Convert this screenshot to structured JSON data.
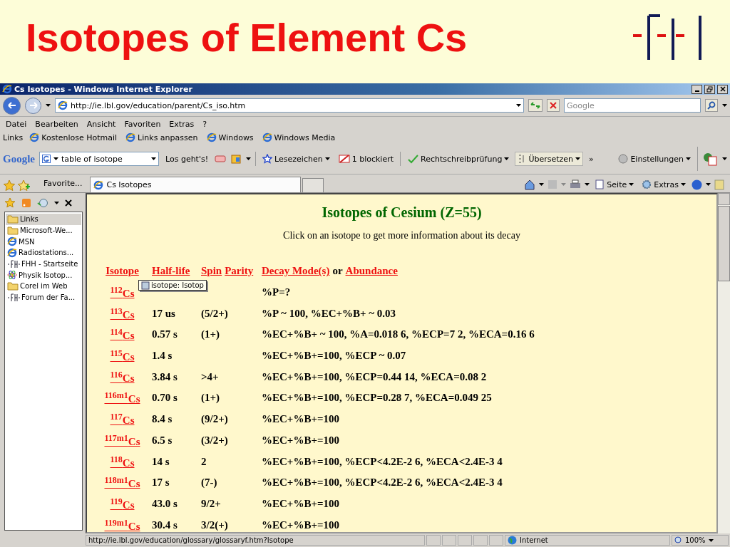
{
  "slide": {
    "title": "Isotopes of Element Cs"
  },
  "browser": {
    "title": "Cs Isotopes - Windows Internet Explorer",
    "address": "http://ie.lbl.gov/education/parent/Cs_iso.htm",
    "search_placeholder": "Google",
    "menu": [
      "Datei",
      "Bearbeiten",
      "Ansicht",
      "Favoriten",
      "Extras",
      "?"
    ],
    "links_bar": {
      "label": "Links",
      "items": [
        "Kostenlose Hotmail",
        "Links anpassen",
        "Windows",
        "Windows Media"
      ]
    },
    "google_toolbar": {
      "logo": "Google",
      "query": "table of isotope",
      "go": "Los geht's!",
      "bookmarks": "Lesezeichen",
      "blocked": "1 blockiert",
      "spellcheck": "Rechtschreibprüfung",
      "translate": "Übersetzen",
      "more": "»",
      "settings": "Einstellungen"
    },
    "favorites_button": "Favorite...",
    "tabs": [
      {
        "label": "Cs Isotopes",
        "selected": true
      }
    ],
    "commands": [
      "Seite",
      "Extras"
    ],
    "sidebar": {
      "items": [
        {
          "kind": "folder",
          "label": "Links",
          "selected": true
        },
        {
          "kind": "folder",
          "label": "Microsoft-We...",
          "selected": false
        },
        {
          "kind": "ie",
          "label": "MSN",
          "selected": false
        },
        {
          "kind": "ie",
          "label": "Radiostations...",
          "selected": false
        },
        {
          "kind": "fh",
          "label": "FHH - Startseite",
          "selected": false
        },
        {
          "kind": "atom",
          "label": "Physik Isotop...",
          "selected": false
        },
        {
          "kind": "folder",
          "label": "Corel im Web",
          "selected": false
        },
        {
          "kind": "fh",
          "label": "Forum der Fa...",
          "selected": false
        }
      ]
    },
    "page": {
      "heading": "Isotopes of Cesium (Z=55)",
      "instruction": "Click on an isotope to get more information about its decay",
      "header": [
        [
          {
            "kind": "link",
            "text": "Isotope"
          }
        ],
        [
          {
            "kind": "link",
            "text": "Half-life"
          }
        ],
        [
          {
            "kind": "link",
            "text": "Spin"
          },
          {
            "kind": "link",
            "text": "Parity"
          }
        ],
        [
          {
            "kind": "link",
            "text": "Decay Mode(s)"
          },
          {
            "kind": "text",
            "text": "or"
          },
          {
            "kind": "link",
            "text": "Abundance"
          }
        ]
      ],
      "rows": [
        {
          "isotope": "$^{112}$Cs",
          "decay": "%P=?"
        },
        {
          "isotope": "$^{113}$Cs",
          "half_life": "17 us",
          "spin": "(5/2+)",
          "decay": "%P ~ 100, %EC+%B+ ~ 0.03"
        },
        {
          "isotope": "$^{114}$Cs",
          "half_life": "0.57 s",
          "spin": "(1+)",
          "decay": "%EC+%B+ ~ 100, %A=0.018 6, %ECP=7 2, %ECA=0.16 6"
        },
        {
          "isotope": "$^{115}$Cs",
          "half_life": "1.4 s",
          "decay": "%EC+%B+=100, %ECP ~ 0.07"
        },
        {
          "isotope": "$^{116}$Cs",
          "half_life": "3.84 s",
          "spin": ">4+",
          "decay": "%EC+%B+=100, %ECP=0.44 14, %ECA=0.08 2"
        },
        {
          "isotope": "$^{116m1}$Cs",
          "half_life": "0.70 s",
          "spin": "(1+)",
          "decay": "%EC+%B+=100, %ECP=0.28 7, %ECA=0.049 25"
        },
        {
          "isotope": "$^{117}$Cs",
          "half_life": "8.4 s",
          "spin": "(9/2+)",
          "decay": "%EC+%B+=100"
        },
        {
          "isotope": "$^{117m1}$Cs",
          "half_life": "6.5 s",
          "spin": "(3/2+)",
          "decay": "%EC+%B+=100"
        },
        {
          "isotope": "$^{118}$Cs",
          "half_life": "14 s",
          "spin": "2",
          "decay": "%EC+%B+=100, %ECP<4.2E-2 6, %ECA<2.4E-3 4"
        },
        {
          "isotope": "$^{118m1}$Cs",
          "half_life": "17 s",
          "spin": "(7-)",
          "decay": "%EC+%B+=100, %ECP<4.2E-2 6, %ECA<2.4E-3 4"
        },
        {
          "isotope": "$^{119}$Cs",
          "half_life": "43.0 s",
          "spin": "9/2+",
          "decay": "%EC+%B+=100"
        },
        {
          "isotope": "$^{119m1}$Cs",
          "half_life": "30.4 s",
          "spin": "3/2(+)",
          "decay": "%EC+%B+=100"
        }
      ]
    },
    "tooltip": "isotope: Isotop",
    "status_bar": {
      "url": "http://ie.lbl.gov/education/glossary/glossaryf.htm?Isotope",
      "zone": "Internet",
      "zoom": "100%"
    }
  }
}
